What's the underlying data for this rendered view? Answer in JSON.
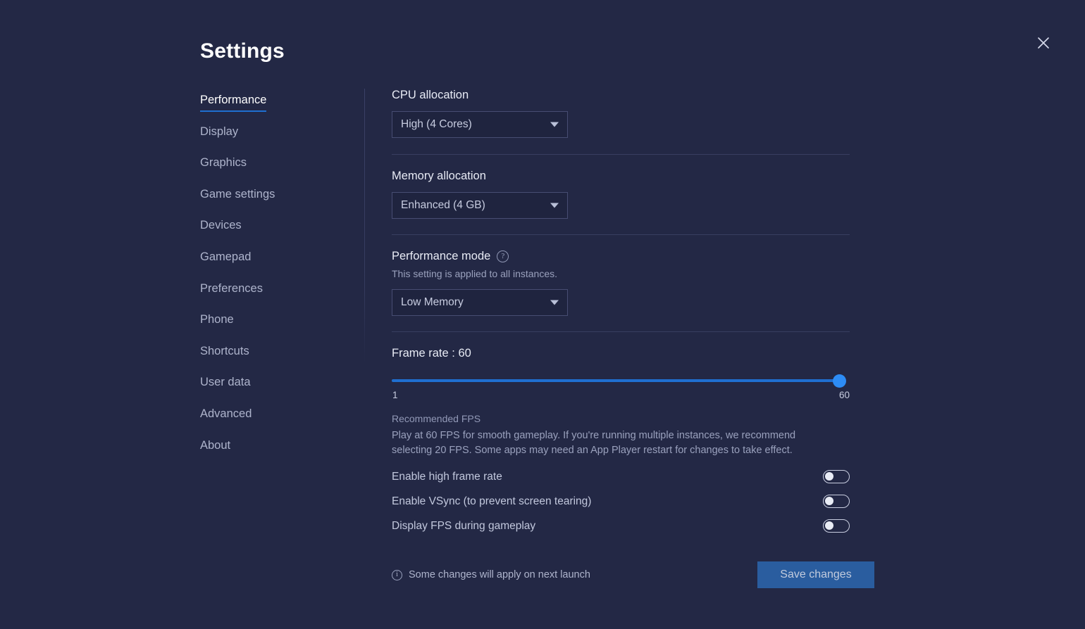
{
  "window": {
    "title": "Settings",
    "close_label": "close-icon"
  },
  "sidebar": {
    "items": [
      {
        "label": "Performance",
        "active": true
      },
      {
        "label": "Display",
        "active": false
      },
      {
        "label": "Graphics",
        "active": false
      },
      {
        "label": "Game settings",
        "active": false
      },
      {
        "label": "Devices",
        "active": false
      },
      {
        "label": "Gamepad",
        "active": false
      },
      {
        "label": "Preferences",
        "active": false
      },
      {
        "label": "Phone",
        "active": false
      },
      {
        "label": "Shortcuts",
        "active": false
      },
      {
        "label": "User data",
        "active": false
      },
      {
        "label": "Advanced",
        "active": false
      },
      {
        "label": "About",
        "active": false
      }
    ]
  },
  "main": {
    "cpu": {
      "label": "CPU allocation",
      "value": "High (4 Cores)"
    },
    "memory": {
      "label": "Memory allocation",
      "value": "Enhanced (4 GB)"
    },
    "performance_mode": {
      "label": "Performance mode",
      "help_glyph": "?",
      "description": "This setting is applied to all instances.",
      "value": "Low Memory"
    },
    "frame_rate": {
      "title": "Frame rate : 60",
      "value": 60,
      "min": 1,
      "max": 60,
      "min_label": "1",
      "max_label": "60",
      "recommended_title": "Recommended FPS",
      "recommended_body": "Play at 60 FPS for smooth gameplay. If you're running multiple instances, we recommend selecting 20 FPS. Some apps may need an App Player restart for changes to take effect."
    },
    "toggles": [
      {
        "label": "Enable high frame rate",
        "on": false
      },
      {
        "label": "Enable VSync (to prevent screen tearing)",
        "on": false
      },
      {
        "label": "Display FPS during gameplay",
        "on": false
      }
    ]
  },
  "footer": {
    "info_glyph": "i",
    "note": "Some changes will apply on next launch",
    "save_label": "Save changes"
  },
  "colors": {
    "background": "#232845",
    "accent": "#1f6fd0",
    "thumb": "#2d8cf5",
    "save_button": "#2a5d9f",
    "text_primary": "#e8ebf5",
    "text_muted": "#9aa1bd"
  }
}
